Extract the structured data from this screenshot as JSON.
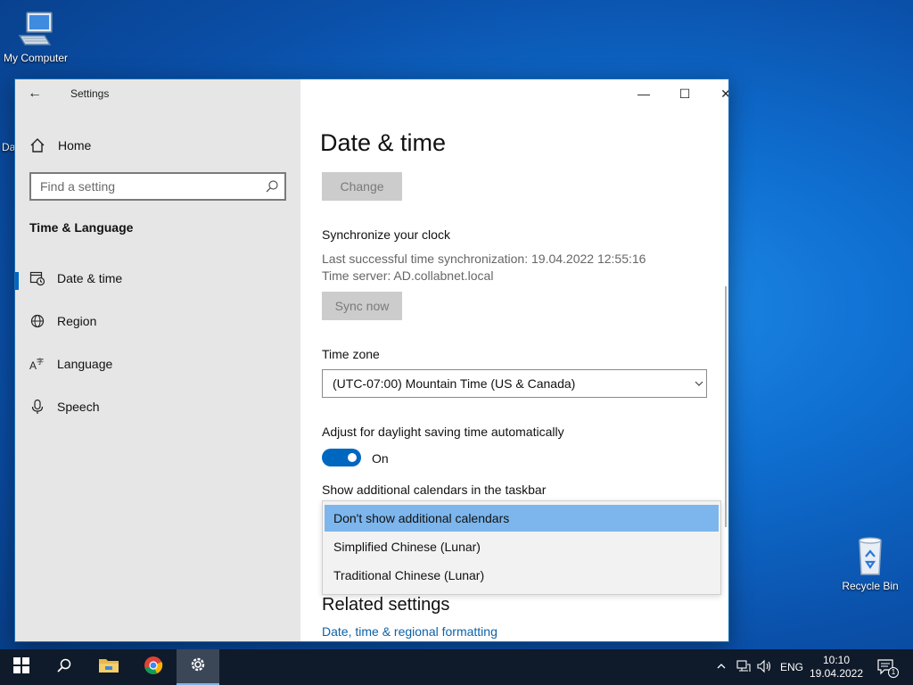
{
  "desktop": {
    "my_computer": "My Computer",
    "recycle_bin": "Recycle Bin",
    "partial_icon_text": "Da"
  },
  "window": {
    "app_title": "Settings",
    "controls": {
      "minimize": "—",
      "maximize": "☐",
      "close": "✕"
    }
  },
  "sidebar": {
    "home_label": "Home",
    "search_placeholder": "Find a setting",
    "section_title": "Time & Language",
    "items": [
      {
        "label": "Date & time",
        "icon": "calendar-clock-icon",
        "selected": true
      },
      {
        "label": "Region",
        "icon": "globe-icon",
        "selected": false
      },
      {
        "label": "Language",
        "icon": "language-icon",
        "selected": false
      },
      {
        "label": "Speech",
        "icon": "microphone-icon",
        "selected": false
      }
    ]
  },
  "main": {
    "page_title": "Date & time",
    "change_button": "Change",
    "sync_heading": "Synchronize your clock",
    "last_sync": "Last successful time synchronization: 19.04.2022 12:55:16",
    "time_server": "Time server: AD.collabnet.local",
    "sync_button": "Sync now",
    "timezone_label": "Time zone",
    "timezone_value": "(UTC-07:00) Mountain Time (US & Canada)",
    "dst_label": "Adjust for daylight saving time automatically",
    "dst_state": "On",
    "calendars_label": "Show additional calendars in the taskbar",
    "calendar_options": [
      "Don't show additional calendars",
      "Simplified Chinese (Lunar)",
      "Traditional Chinese (Lunar)"
    ],
    "related_title": "Related settings",
    "related_link": "Date, time & regional formatting"
  },
  "taskbar": {
    "language": "ENG",
    "time": "10:10",
    "date": "19.04.2022",
    "notification_count": "1"
  },
  "colors": {
    "accent": "#0067c0",
    "selection": "#7cb6ed",
    "link": "#0b62a8",
    "taskbar": "#0f1a2a"
  }
}
